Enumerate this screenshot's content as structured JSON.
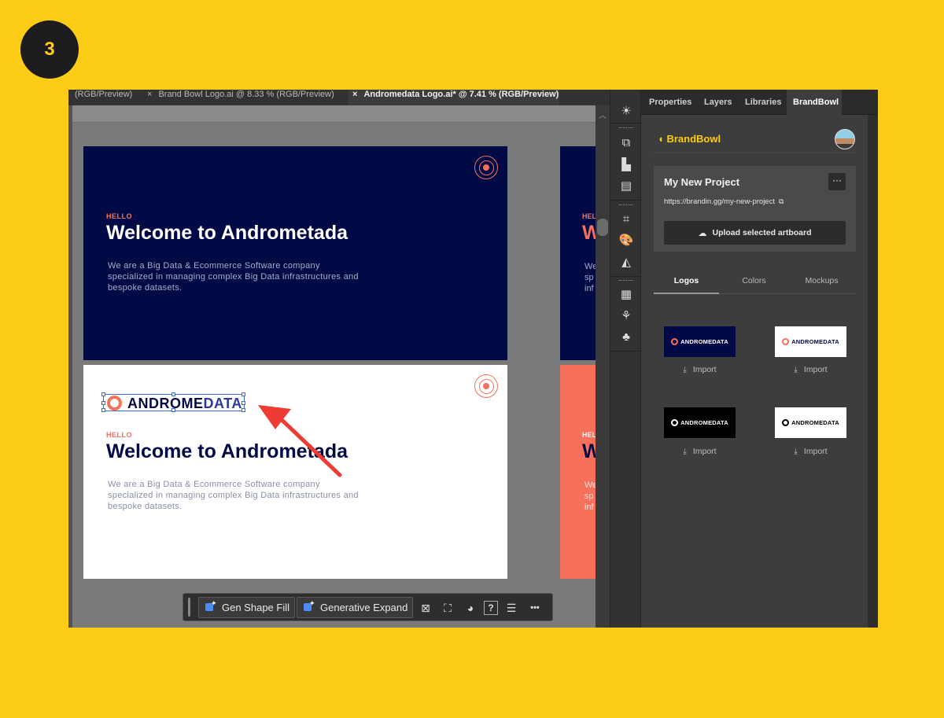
{
  "step": "3",
  "tabs": [
    {
      "label": "(RGB/Preview)",
      "close": "",
      "active": false
    },
    {
      "label": "Brand Bowl Logo.ai @ 8.33 % (RGB/Preview)",
      "close": "×",
      "active": false
    },
    {
      "label": "Andromedata Logo.ai* @ 7.41 % (RGB/Preview)",
      "close": "×",
      "active": true
    }
  ],
  "artboards": {
    "hello": "HELLO",
    "welcome": "Welcome to Andrometada",
    "description": "We are a Big Data & Ecommerce Software company specialized in managing complex Big Data infrastructures and bespoke datasets.",
    "partial_hello": "HEL",
    "partial_welcome": "W",
    "partial_desc": "We\nsp\ninf"
  },
  "logo": {
    "text_a": "ANDROME",
    "text_b": "DATA"
  },
  "toolbar": {
    "gen_shape_fill": "Gen Shape Fill",
    "generative_expand": "Generative Expand",
    "help": "?",
    "more": "•••"
  },
  "panel": {
    "tabs": [
      "Properties",
      "Layers",
      "Libraries",
      "BrandBowl"
    ],
    "active_tab": "BrandBowl",
    "brand": "BrandBowl",
    "project": {
      "title": "My New Project",
      "menu": "···",
      "url": "https://brandin.gg/my-new-project",
      "upload_label": "Upload selected artboard"
    },
    "subtabs": [
      "Logos",
      "Colors",
      "Mockups"
    ],
    "active_subtab": "Logos",
    "logos": [
      {
        "bg": "#020A45",
        "ring": "#F6705B",
        "fg": "#ffffff",
        "text": "ANDROMEDATA",
        "import": "Import"
      },
      {
        "bg": "#ffffff",
        "ring": "#F6705B",
        "fg": "#020A45",
        "text": "ANDROMEDATA",
        "import": "Import"
      },
      {
        "bg": "#000000",
        "ring": "#ffffff",
        "fg": "#ffffff",
        "text": "ANDROMEDATA",
        "import": "Import"
      },
      {
        "bg": "#ffffff",
        "ring": "#000000",
        "fg": "#000000",
        "text": "ANDROMEDATA",
        "import": "Import"
      }
    ]
  },
  "colors": {
    "background": "#FCCC16",
    "navy": "#020A45",
    "coral": "#F6705B",
    "brand_yellow": "#FCCC16"
  }
}
